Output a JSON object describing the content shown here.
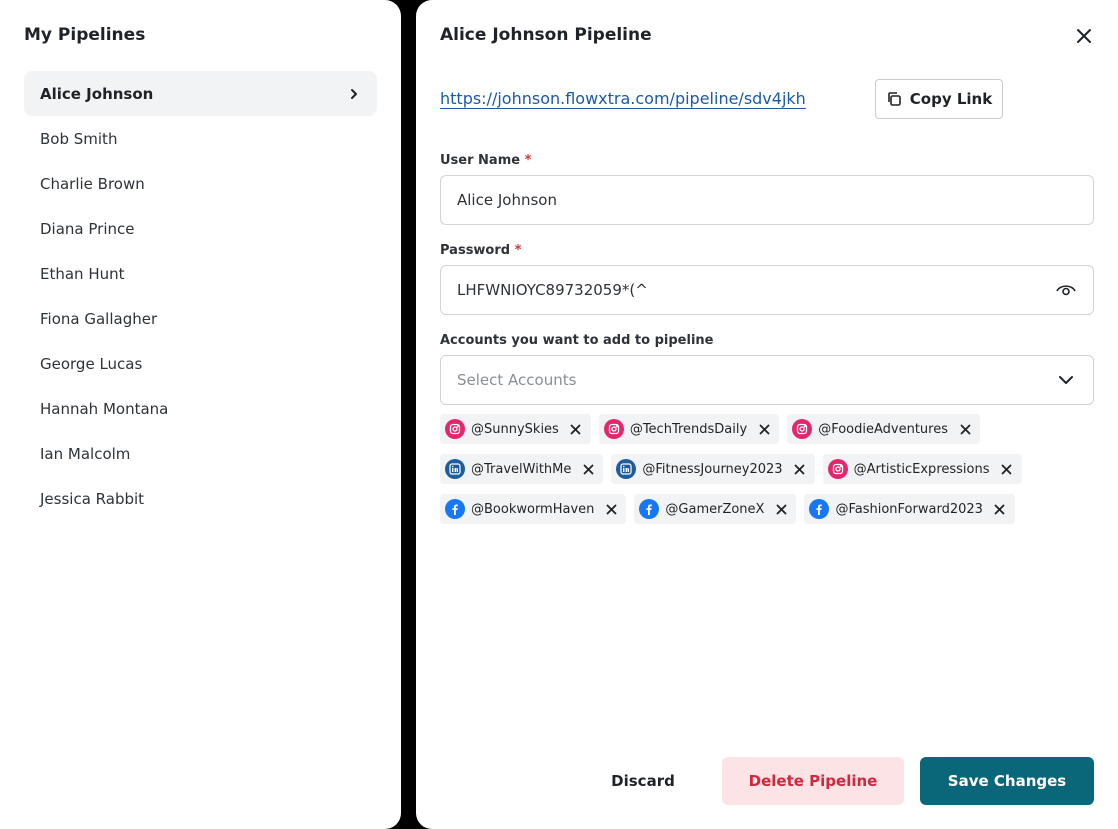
{
  "sidebar": {
    "title": "My Pipelines",
    "items": [
      {
        "label": "Alice Johnson",
        "active": true
      },
      {
        "label": "Bob Smith"
      },
      {
        "label": "Charlie Brown"
      },
      {
        "label": "Diana Prince"
      },
      {
        "label": "Ethan Hunt"
      },
      {
        "label": "Fiona Gallagher"
      },
      {
        "label": "George Lucas"
      },
      {
        "label": "Hannah Montana"
      },
      {
        "label": "Ian Malcolm"
      },
      {
        "label": "Jessica Rabbit"
      }
    ]
  },
  "dialog": {
    "title": "Alice Johnson Pipeline",
    "close_icon": "close-icon",
    "link": "https://johnson.flowxtra.com/pipeline/sdv4jkh",
    "copy_label": "Copy Link",
    "username": {
      "label": "User Name",
      "required_mark": "*",
      "value": "Alice Johnson"
    },
    "password": {
      "label": "Password",
      "required_mark": "*",
      "value": "LHFWNIOYC89732059*(^",
      "toggle_icon": "eye-icon"
    },
    "accounts": {
      "label": "Accounts you want to add to pipeline",
      "placeholder": "Select Accounts",
      "selected": [
        [
          {
            "network": "instagram",
            "handle": "@SunnySkies"
          },
          {
            "network": "instagram",
            "handle": "@TechTrendsDaily"
          },
          {
            "network": "instagram",
            "handle": "@FoodieAdventures"
          }
        ],
        [
          {
            "network": "linkedin",
            "handle": "@TravelWithMe"
          },
          {
            "network": "linkedin",
            "handle": "@FitnessJourney2023"
          },
          {
            "network": "instagram",
            "handle": "@ArtisticExpressions"
          }
        ],
        [
          {
            "network": "facebook",
            "handle": "@BookwormHaven"
          },
          {
            "network": "facebook",
            "handle": "@GamerZoneX"
          },
          {
            "network": "facebook",
            "handle": "@FashionForward2023"
          }
        ]
      ]
    },
    "buttons": {
      "discard": "Discard",
      "delete": "Delete Pipeline",
      "save": "Save Changes"
    },
    "colors": {
      "accent": "#0a6679",
      "link": "#1a5aa8",
      "danger": "#d0283c",
      "danger_bg": "#fbe3e6",
      "instagram": "#e4266f",
      "linkedin": "#1e5d9d",
      "facebook": "#1877f2"
    }
  }
}
